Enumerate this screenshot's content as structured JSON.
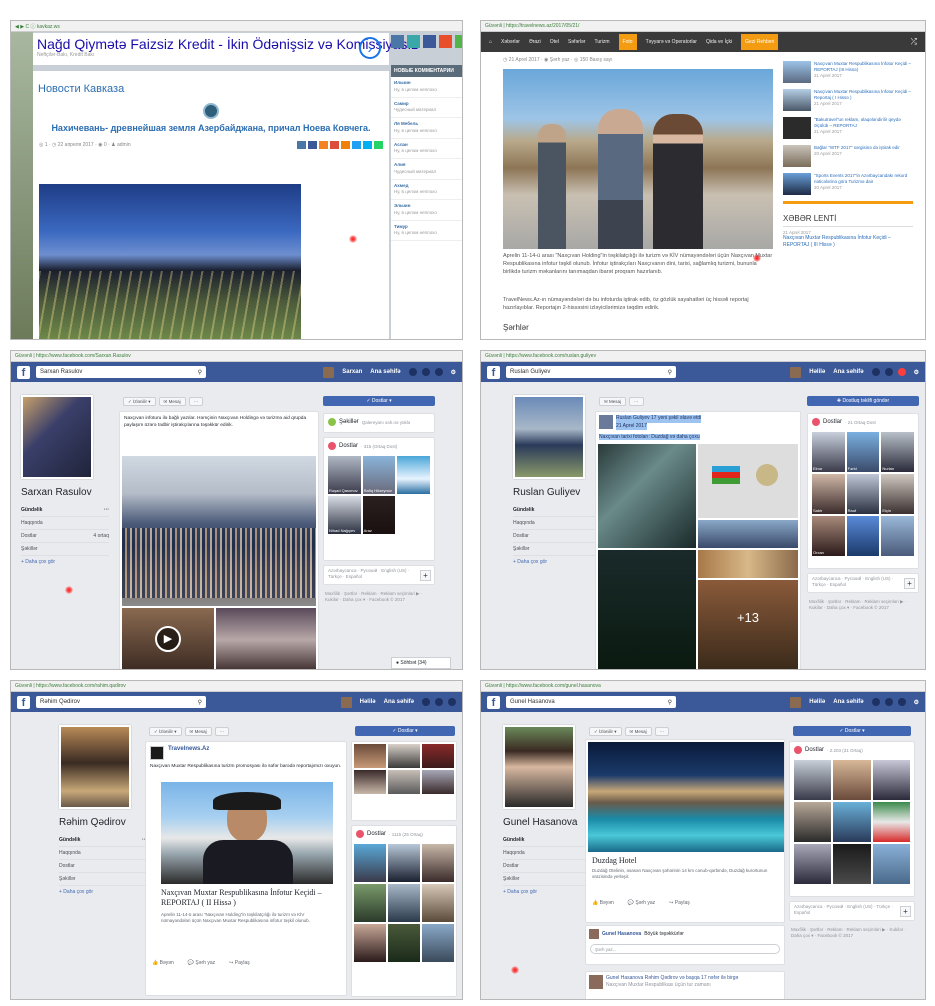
{
  "p1": {
    "url": "◀ ▶ C ⓘ kavkaz.ws",
    "ad_title": "Nağd Qiymətə Faizsiz Kredit - İkin Ödənişsiz və Komissiyasız",
    "ad_sub": "Neftçilər-Bakı, Kredit Bakı",
    "site_heading": "Новости Кавказа",
    "article_title": "Нахичевань- древнейшая земля Азербайджана, причал Ноева Ковчега.",
    "meta": "◎ 1 · ◷ 22 апреля 2017 · ◉ 0 · ♟ admin",
    "sidebar_header": "НОВЫЕ КОММЕНТАРИИ",
    "comments": [
      {
        "name": "Ильчин",
        "text": "Ну, в целом неплохо"
      },
      {
        "name": "Самир",
        "text": "Чудесный материал"
      },
      {
        "name": "Ля Мебель",
        "text": "Ну, в целом неплохо"
      },
      {
        "name": "Аслан",
        "text": "Ну, в целом неплохо"
      },
      {
        "name": "Алия",
        "text": "Чудесный материал"
      },
      {
        "name": "Ахмед",
        "text": "Ну, в целом неплохо"
      },
      {
        "name": "Эльчин",
        "text": "Ну, в целом неплохо"
      },
      {
        "name": "Тимур",
        "text": "Ну, в целом неплохо"
      }
    ]
  },
  "p2": {
    "url": "Güvənli | https://travelnews.az/2017/05/21/",
    "nav": [
      "Xəbərlər",
      "Ərazi",
      "Otel",
      "Səfərlər",
      "Turizm"
    ],
    "nav_active": "Foto",
    "nav_more": "Təyyarə və Operatorlar",
    "nav_extra": "Qida ve İçki",
    "nav_highlight": "Gezi Rehberi",
    "meta": "◷ 21 Aprel 2017 · ◉ Şərh yaz · ◎ 150 Baxış sayı",
    "body1": "Aprelin 11-14-ü arası \"Naxçıvan Holding\"in təşkilatçılığı ilə turizm və KİV nümayəndələri üçün Naxçıvan Muxtar Respublikasına infotur təşkil olunub. İnfotur iştirakçıları Naxçıvanın dini, tarixi, sağlamlıq turizmi, bununla birlikdə turizm məkanlarını tanımaqdan ibarət proqram hazırlanıb.",
    "body2": "TravelNews.Az-ın nümayəndələri də bu infoturda iştirak edib, öz gözlük sayahatləri üç hissəli reportaj hazırlayıblar. Reportajın 2-hissəsini izləyicilərimizə təqdim edirik.",
    "comments_heading": "Şərhlər",
    "side_items": [
      {
        "title": "Naxçıvan Muxtar Respublikasına İnfotur Keçidi – REPORTAJ (III Hissə)",
        "date": "21 Aprel 2017"
      },
      {
        "title": "Naxçıvan Muxtar Respublikasına İnfotur Keçidi – Reportaj ( I Hissə )",
        "date": "21 Aprel 2017"
      },
      {
        "title": "\"Bakutravel\"un reklam, əlaqələndirilir qeydə ölçülüb – REPORTAJ",
        "date": "21 Aprel 2017"
      },
      {
        "title": "Bağlar \"WTF 2017\" sərgisinə də iştirak edir",
        "date": "20 Aprel 2017"
      },
      {
        "title": "\"Sports Events 2017\"in Azərbaycandakı rekord nəticələrinə görə Turizmə dair",
        "date": "20 Aprel 2017"
      }
    ],
    "lenti": "XƏBƏR LENTİ",
    "lenti_date": "21 Aprel 2017",
    "lenti_item": "Naxçıvan Muxtar Respublikasına İnfotur Keçidi – REPORTAJ ( III Hissə )"
  },
  "fb_common": {
    "nav_home": "Ana səhifə",
    "left_nav": [
      "Gündəlik",
      "Haqqında",
      "Dostlar",
      "Şəkillər"
    ],
    "more": "+ Daha çox gör",
    "friends": "Dostlar",
    "add_friend": "✓ Dostlar ▾",
    "msg": "✉ Mesaj",
    "follow": "✓ İzlənilir ▾",
    "lang": "Azərbaycanca · Русский · English (US) · Türkçe · Español",
    "footer": "Məxfilik · Şərtlər · Reklam · Reklam seçimləri ▶ · Kukilər · Daha çox ▾ · Facebook © 2017"
  },
  "p3": {
    "url": "Güvənli | https://www.facebook.com/Sarxan.Rasulov",
    "search": "Sarxan Rasulov",
    "user": "Sarxan",
    "name": "Sarxan Rasulov",
    "friends_count": "4 ortaq",
    "photos_label": "Şəkillər",
    "photos_hint": "Qalereyanı səh.nə yüklə",
    "friends_title": "Dostlar",
    "friends_sub": "· 315 (Ortaq Dost)",
    "friend_names": [
      "Rəşad Qasımov",
      "Rafiq Hüseynov",
      "",
      "Nihad Nağıyev",
      "Araz"
    ],
    "post_text": "Naxçıvan infoturu ilə bağlı yazılar. Həmçinin Naxçıvan Holdingə və turizmə aid qrupda paylaşım üzərə tədbir iştirakçılarına təşəkkür edirik.",
    "chat": "● Söhbət (34)"
  },
  "p4": {
    "url": "Güvənli | https://www.facebook.com/ruslan.guliyev",
    "search": "Ruslan Guliyev",
    "user": "Həlilə",
    "name": "Ruslan Guliyev",
    "add": "✚ Dostluq təklifi göndər",
    "post_link1": "Ruslan Guliyev 17 yeni şəkil əlavə etdi",
    "post_link2": "21 Aprel 2017",
    "post_link3": "Naxçıvan tarixi fotoları: Duzdağ və daha çoxu",
    "plus": "+13",
    "friends_sub": "· 21 Ortaq Dost",
    "friend_names": [
      "Elnur",
      "Fərid",
      "Nurlan",
      "Sabir",
      "Rauf",
      "Elçin",
      "Orxan",
      "",
      ""
    ]
  },
  "p5": {
    "url": "Güvənli | https://www.facebook.com/rahim.qadirov",
    "search": "Rəhim Qədirov",
    "user": "Həlilə",
    "name": "Rəhim Qədirov",
    "page": "Travelnews.Az",
    "post_intro": "Naxçıvan Muxtar Respublikasına turizm promosyası ilə səfər barədə reportajımızı oxuyun.",
    "link_title": "Naxçıvan Muxtar Respublikasına İnfotur Keçidi – REPORTAJ ( II Hissə )",
    "link_desc": "Aprelin 11-14-ü arası \"Naxçıvan Holding\"in təşkilatçılığı ilə turizm və KİV nümayəndələri üçün Naxçıvan Muxtar Respublikasına infotur təşkil olunub.",
    "like": "👍 Bəyən",
    "comment": "💬 Şərh yaz",
    "share": "↪ Paylaş",
    "friends_sub": "· 1115 (25 Ortaq)"
  },
  "p6": {
    "url": "Güvənli | https://www.facebook.com/gunel.hasanova",
    "search": "Gunel Hasanova",
    "user": "Həlilə",
    "name": "Gunel Hasanova",
    "friends_sub": "· 2.203 (31 Ortaq)",
    "hotel": "Duzdag Hotel",
    "hotel_desc": "Duzdağ Otelinin, əsasən Naxçıvan şəhərinin 14 km cənub-qərbində, Duzdağ kurortunun ərazisində yerləşir.",
    "comment1_name": "Gunel Hasanova",
    "comment1": "Böyük təşəkkürlər",
    "comment_placeholder": "Şərh yaz...",
    "bottom_post": "Gunel Hasanova Rəhim Qədirov və başqa 17 nəfər ilə birgə",
    "bottom_sub": "Naxçıvan Muxtar Respublikası üçün tur zamanı"
  }
}
